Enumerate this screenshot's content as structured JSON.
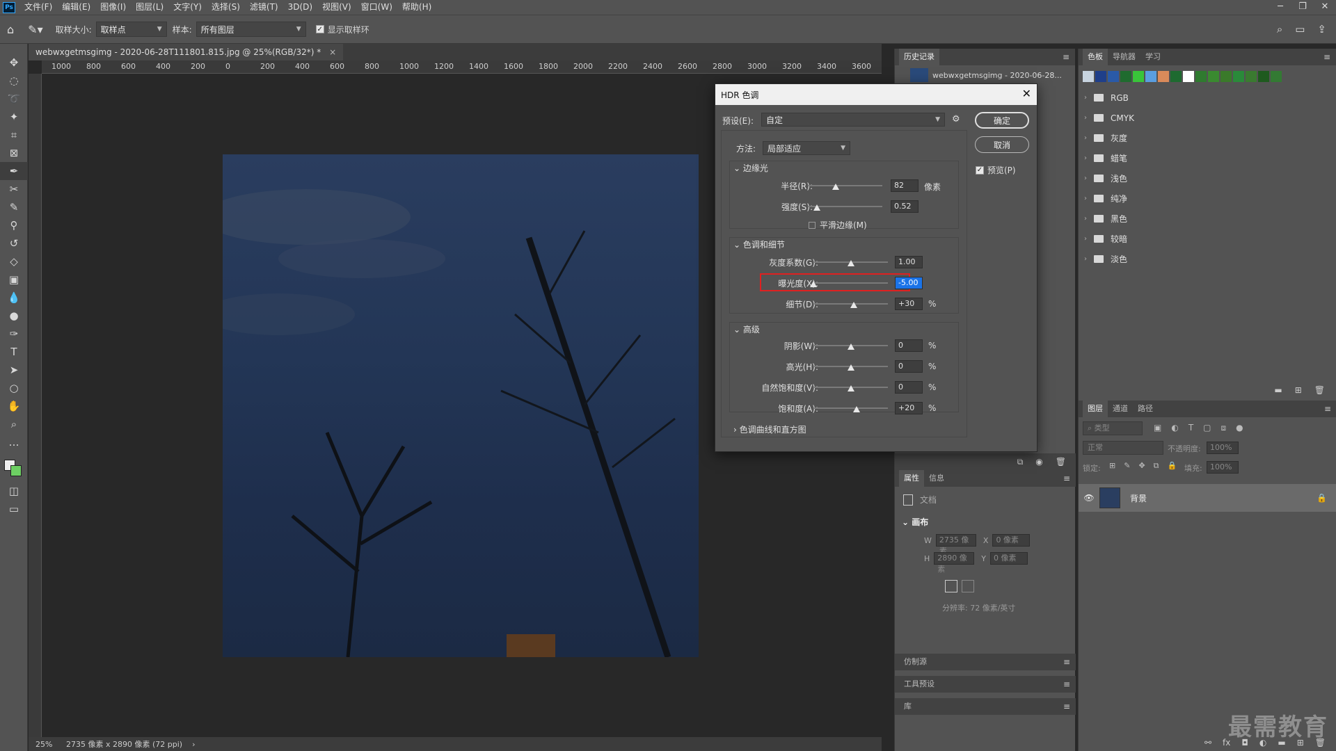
{
  "menu": {
    "app_logo": "Ps",
    "items": [
      "文件(F)",
      "编辑(E)",
      "图像(I)",
      "图层(L)",
      "文字(Y)",
      "选择(S)",
      "滤镜(T)",
      "3D(D)",
      "视图(V)",
      "窗口(W)",
      "帮助(H)"
    ]
  },
  "options": {
    "sample_size_label": "取样大小:",
    "sample_size_value": "取样点",
    "sample_label": "样本:",
    "sample_value": "所有图层",
    "show_ring_label": "显示取样环"
  },
  "document": {
    "tab_title": "webwxgetmsgimg - 2020-06-28T111801.815.jpg @ 25%(RGB/32*) *",
    "zoom": "25%",
    "dimensions": "2735 像素 x 2890 像素 (72 ppi)",
    "ruler_ticks": [
      "1000",
      "800",
      "600",
      "400",
      "200",
      "0",
      "200",
      "400",
      "600",
      "800",
      "1000",
      "1200",
      "1400",
      "1600",
      "1800",
      "2000",
      "2200",
      "2400",
      "2600",
      "2800",
      "3000",
      "3200",
      "3400",
      "3600"
    ]
  },
  "history_panel": {
    "tab": "历史记录",
    "snapshot_label": "webwxgetmsgimg - 2020-06-28..."
  },
  "properties_panel": {
    "tabs": [
      "属性",
      "信息"
    ],
    "doc_label": "文档",
    "canvas_header": "画布",
    "w_label": "W",
    "w_value": "2735 像素",
    "x_label": "X",
    "x_value": "0 像素",
    "h_label": "H",
    "h_value": "2890 像素",
    "y_label": "Y",
    "y_value": "0 像素",
    "resolution": "分辨率: 72 像素/英寸"
  },
  "collapsed_panels": [
    "仿制源",
    "工具预设",
    "库"
  ],
  "swatches_panel": {
    "tabs": [
      "色板",
      "导航器",
      "学习"
    ],
    "colors": [
      "#c8d4e0",
      "#1f3f8a",
      "#2a5aa8",
      "#1f6b2f",
      "#39c43a",
      "#5a9ee0",
      "#d98a5a",
      "#1e6a30",
      "#ffffff",
      "#2f7a2f",
      "#3a8a30",
      "#3a7a2a",
      "#2a8a3a",
      "#3a7a30",
      "#1e5a1e",
      "#337a33"
    ],
    "groups": [
      "RGB",
      "CMYK",
      "灰度",
      "蜡笔",
      "浅色",
      "纯净",
      "黑色",
      "较暗",
      "淡色"
    ]
  },
  "layers_panel": {
    "tabs": [
      "图层",
      "通道",
      "路径"
    ],
    "search_placeholder": "类型",
    "blend_mode": "正常",
    "opacity_label": "不透明度:",
    "opacity_value": "100%",
    "lock_label": "锁定:",
    "fill_label": "填充:",
    "fill_value": "100%",
    "layer_name": "背景"
  },
  "dialog": {
    "title": "HDR 色调",
    "preset_label": "预设(E):",
    "preset_value": "自定",
    "ok": "确定",
    "cancel": "取消",
    "preview_label": "预览(P)",
    "method_label": "方法:",
    "method_value": "局部适应",
    "edge_glow": {
      "header": "边缘光",
      "radius_label": "半径(R):",
      "radius_value": "82",
      "radius_unit": "像素",
      "strength_label": "强度(S):",
      "strength_value": "0.52",
      "smooth_label": "平滑边缘(M)"
    },
    "tone_detail": {
      "header": "色调和细节",
      "gamma_label": "灰度系数(G):",
      "gamma_value": "1.00",
      "exposure_label": "曝光度(X):",
      "exposure_value": "-5.00",
      "detail_label": "细节(D):",
      "detail_value": "+30",
      "detail_unit": "%"
    },
    "advanced": {
      "header": "高级",
      "shadow_label": "阴影(W):",
      "shadow_value": "0",
      "highlight_label": "高光(H):",
      "highlight_value": "0",
      "vibrance_label": "自然饱和度(V):",
      "vibrance_value": "0",
      "saturation_label": "饱和度(A):",
      "saturation_value": "+20",
      "unit": "%"
    },
    "curve_header": "色调曲线和直方图"
  },
  "watermark": "最需教育"
}
